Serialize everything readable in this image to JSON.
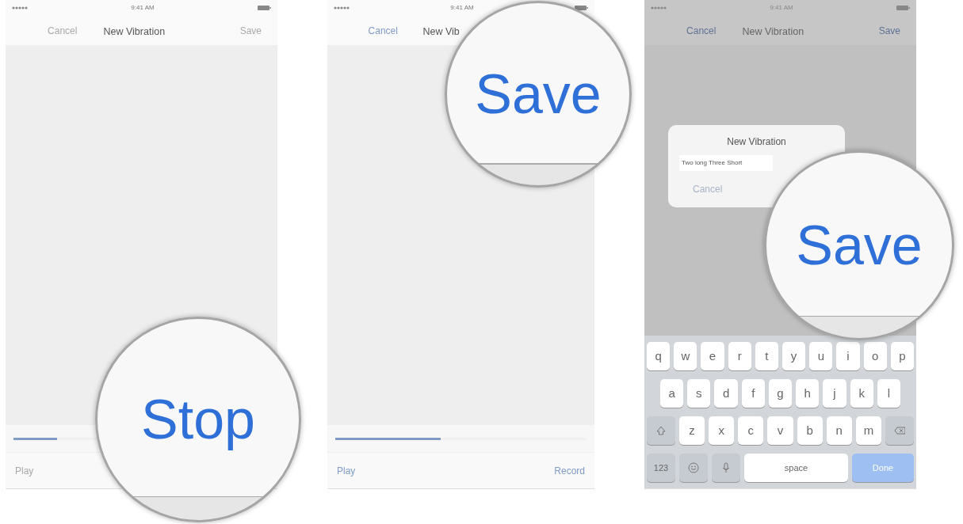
{
  "screens": [
    {
      "kind": "recording",
      "dimmed": false,
      "status_time": "9:41 AM",
      "nav": {
        "left": {
          "label": "Cancel",
          "enabled": false
        },
        "title": "New Vibration",
        "right": {
          "label": "Save",
          "enabled": false
        }
      },
      "progress": {
        "level": 0.17
      },
      "toolbar": {
        "left": {
          "label": "Play",
          "enabled": false
        }
      },
      "magnifier": {
        "label": "Stop"
      }
    },
    {
      "kind": "recording",
      "dimmed": false,
      "status_time": "9:41 AM",
      "nav": {
        "left": {
          "label": "Cancel",
          "enabled": true
        },
        "title": "New Vib"
      },
      "progress": {
        "level": 0.42
      },
      "toolbar": {
        "left": {
          "label": "Play",
          "enabled": true
        },
        "right": {
          "label": "Record",
          "enabled": true
        }
      },
      "magnifier": {
        "label": "Save"
      }
    },
    {
      "kind": "naming",
      "dimmed": true,
      "status_time": "9:41 AM",
      "nav": {
        "left": {
          "label": "Cancel",
          "enabled": true
        },
        "title": "New Vibration",
        "right": {
          "label": "Save",
          "enabled": true
        }
      },
      "alert": {
        "title": "New Vibration",
        "value": "Two long Three Short",
        "buttons": [
          "Cancel"
        ]
      },
      "keyboard": {
        "rows": [
          {
            "keys": [
              {
                "kind": "letter",
                "label": "q"
              },
              {
                "kind": "letter",
                "label": "w"
              },
              {
                "kind": "letter",
                "label": "e"
              },
              {
                "kind": "letter",
                "label": "r"
              },
              {
                "kind": "letter",
                "label": "t"
              },
              {
                "kind": "letter",
                "label": "y"
              },
              {
                "kind": "letter",
                "label": "u"
              },
              {
                "kind": "letter",
                "label": "i"
              },
              {
                "kind": "letter",
                "label": "o"
              },
              {
                "kind": "letter",
                "label": "p"
              }
            ]
          },
          {
            "keys": [
              {
                "kind": "letter",
                "label": "a"
              },
              {
                "kind": "letter",
                "label": "s"
              },
              {
                "kind": "letter",
                "label": "d"
              },
              {
                "kind": "letter",
                "label": "f"
              },
              {
                "kind": "letter",
                "label": "g"
              },
              {
                "kind": "letter",
                "label": "h"
              },
              {
                "kind": "letter",
                "label": "j"
              },
              {
                "kind": "letter",
                "label": "k"
              },
              {
                "kind": "letter",
                "label": "l"
              }
            ]
          },
          {
            "keys": [
              {
                "kind": "shift"
              },
              {
                "kind": "letter",
                "label": "z"
              },
              {
                "kind": "letter",
                "label": "x"
              },
              {
                "kind": "letter",
                "label": "c"
              },
              {
                "kind": "letter",
                "label": "v"
              },
              {
                "kind": "letter",
                "label": "b"
              },
              {
                "kind": "letter",
                "label": "n"
              },
              {
                "kind": "letter",
                "label": "m"
              },
              {
                "kind": "delete"
              }
            ]
          },
          {
            "keys": [
              {
                "kind": "mode",
                "label": "123"
              },
              {
                "kind": "emoji"
              },
              {
                "kind": "mic"
              },
              {
                "kind": "space",
                "label": "space"
              },
              {
                "kind": "return",
                "label": "Done"
              }
            ]
          }
        ]
      },
      "magnifier": {
        "label": "Save"
      }
    }
  ]
}
